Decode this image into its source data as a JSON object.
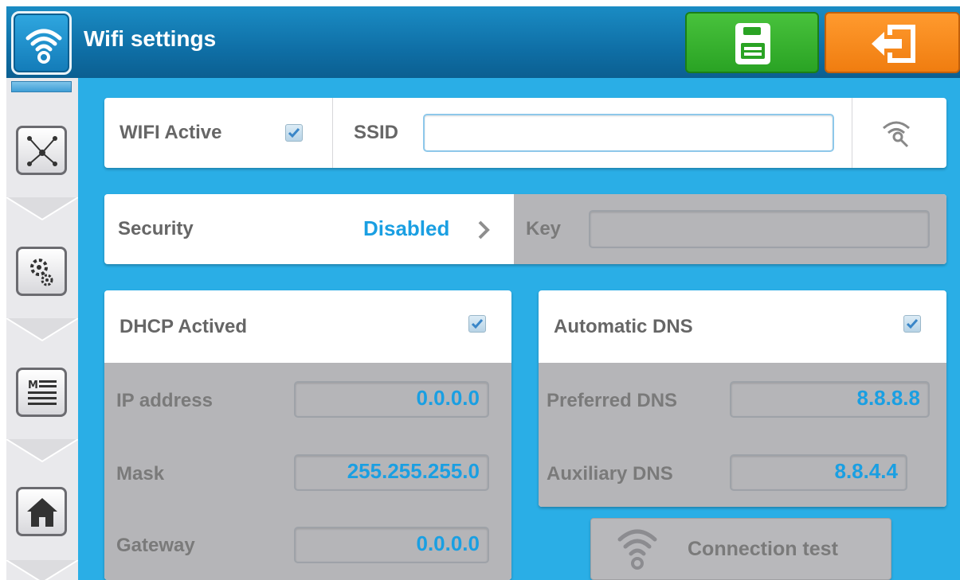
{
  "header": {
    "title": "Wifi settings",
    "app_icon": "wifi-settings-icon",
    "save_icon": "floppy-disk-icon",
    "exit_icon": "exit-arrow-icon"
  },
  "sidebar": {
    "items": [
      {
        "name": "network",
        "icon": "network-nodes-icon"
      },
      {
        "name": "settings",
        "icon": "gears-icon"
      },
      {
        "name": "menu",
        "icon": "menu-list-icon"
      },
      {
        "name": "home",
        "icon": "home-icon"
      }
    ]
  },
  "wifi": {
    "active_label": "WIFI Active",
    "active_checked": true,
    "ssid_label": "SSID",
    "ssid_value": "",
    "scan_icon": "wifi-search-icon"
  },
  "security": {
    "label": "Security",
    "value": "Disabled",
    "key_label": "Key",
    "key_value": ""
  },
  "dhcp": {
    "label": "DHCP Actived",
    "checked": true,
    "ip_label": "IP address",
    "ip_value": "0.0.0.0",
    "mask_label": "Mask",
    "mask_value": "255.255.255.0",
    "gateway_label": "Gateway",
    "gateway_value": "0.0.0.0"
  },
  "dns": {
    "label": "Automatic DNS",
    "checked": true,
    "preferred_label": "Preferred DNS",
    "preferred_value": "8.8.8.8",
    "auxiliary_label": "Auxiliary DNS",
    "auxiliary_value": "8.8.4.4"
  },
  "connection_test": {
    "label": "Connection test",
    "icon": "wifi-signal-icon"
  },
  "colors": {
    "accent": "#1a9fe2",
    "background": "#2aaee6",
    "save": "#2aa324",
    "exit": "#f07d10"
  }
}
